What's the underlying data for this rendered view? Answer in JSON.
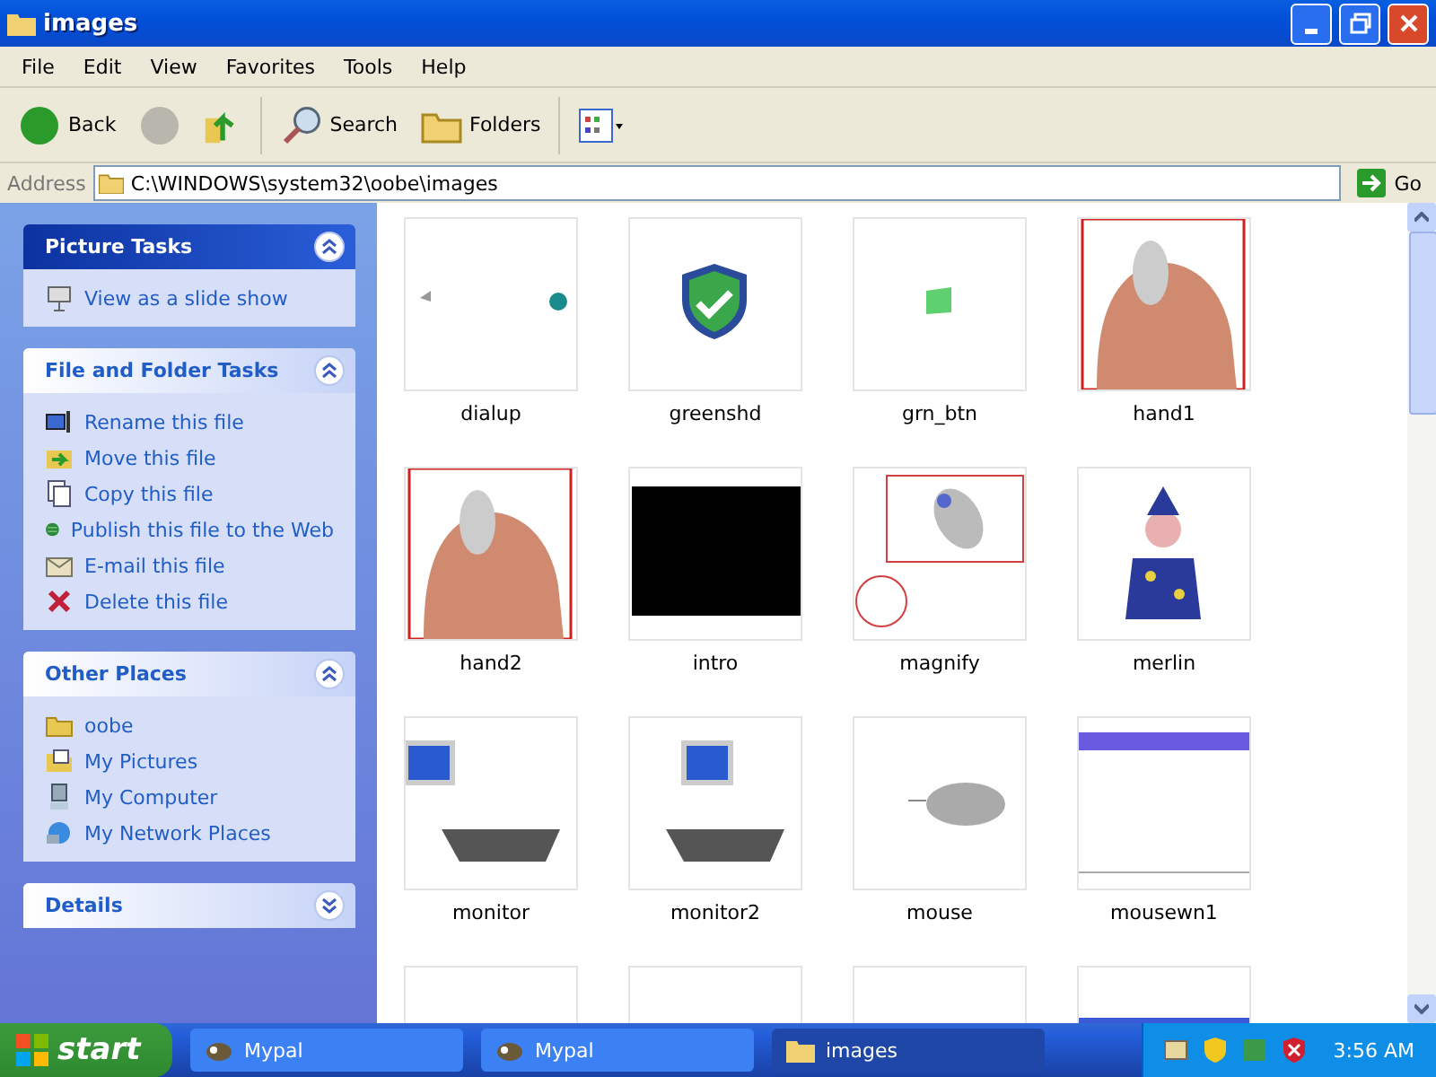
{
  "window": {
    "title": "images"
  },
  "menu": [
    "File",
    "Edit",
    "View",
    "Favorites",
    "Tools",
    "Help"
  ],
  "toolbar": [
    {
      "kind": "back",
      "label": "Back"
    },
    {
      "kind": "forward",
      "disabled": true
    },
    {
      "kind": "up"
    },
    {
      "kind": "search",
      "label": "Search"
    },
    {
      "kind": "folders",
      "label": "Folders"
    },
    {
      "kind": "views"
    }
  ],
  "address": {
    "label": "Address",
    "value": "C:\\WINDOWS\\system32\\oobe\\images",
    "go": "Go"
  },
  "sidebar": [
    {
      "title": "Picture Tasks",
      "primary": true,
      "expanded": true,
      "items": [
        "View as a slide show"
      ]
    },
    {
      "title": "File and Folder Tasks",
      "primary": false,
      "expanded": true,
      "items": [
        "Rename this file",
        "Move this file",
        "Copy this file",
        "Publish this file to the Web",
        "E-mail this file",
        "Delete this file"
      ]
    },
    {
      "title": "Other Places",
      "primary": false,
      "expanded": true,
      "items": [
        "oobe",
        "My Pictures",
        "My Computer",
        "My Network Places"
      ]
    },
    {
      "title": "Details",
      "primary": false,
      "expanded": false
    }
  ],
  "files": [
    {
      "name": "dialup",
      "selected": false
    },
    {
      "name": "greenshd",
      "selected": false
    },
    {
      "name": "grn_btn",
      "selected": false
    },
    {
      "name": "hand1",
      "selected": false
    },
    {
      "name": "hand2",
      "selected": false
    },
    {
      "name": "intro",
      "selected": false
    },
    {
      "name": "magnify",
      "selected": false
    },
    {
      "name": "merlin",
      "selected": false
    },
    {
      "name": "monitor",
      "selected": false
    },
    {
      "name": "monitor2",
      "selected": false
    },
    {
      "name": "mouse",
      "selected": false
    },
    {
      "name": "mousewn1",
      "selected": false
    },
    {
      "selected": false
    },
    {
      "selected": false
    },
    {
      "selected": false
    },
    {
      "selected": false
    }
  ],
  "taskbar": {
    "start": "start",
    "tasks": [
      {
        "label": "Mypal",
        "kind": "app",
        "selected": false
      },
      {
        "label": "Mypal",
        "kind": "app",
        "selected": false
      },
      {
        "label": "images",
        "kind": "folder",
        "selected": true
      }
    ],
    "clock": "3:56 AM"
  }
}
